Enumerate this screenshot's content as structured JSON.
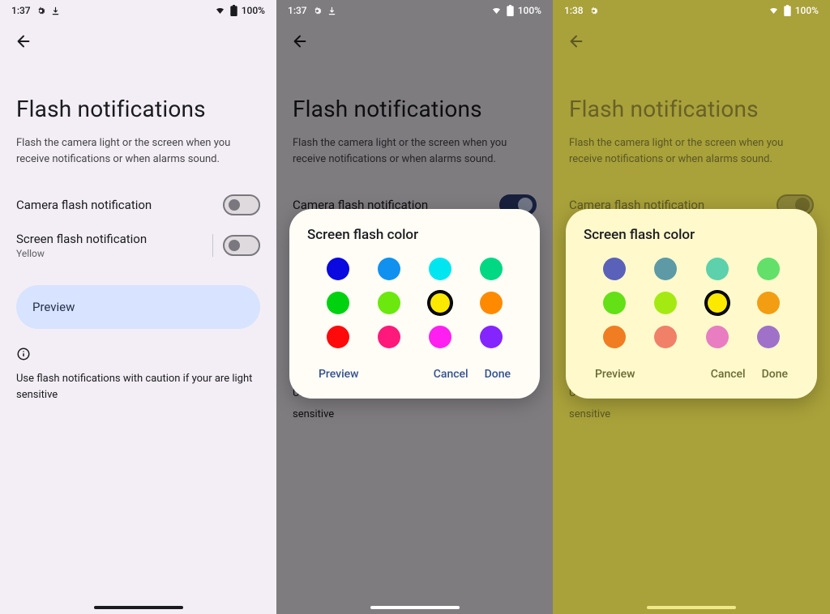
{
  "panel1": {
    "status": {
      "time": "1:37",
      "battery": "100%"
    },
    "title": "Flash notifications",
    "subtitle": "Flash the camera light or the screen when you receive notifications or when alarms sound.",
    "camera_row": "Camera flash notification",
    "screen_row": "Screen flash notification",
    "screen_row_sub": "Yellow",
    "preview": "Preview",
    "caution": "Use flash notifications with caution if your are light sensitive"
  },
  "panel2": {
    "status": {
      "time": "1:37",
      "battery": "100%"
    },
    "title": "Flash notifications",
    "subtitle": "Flash the camera light or the screen when you receive notifications or when alarms sound.",
    "dialog": {
      "title": "Screen flash color",
      "preview": "Preview",
      "cancel": "Cancel",
      "done": "Done",
      "colors": [
        "#0909e0",
        "#1091f0",
        "#00e6f0",
        "#00d884",
        "#00d210",
        "#6be80e",
        "#fbe900",
        "#ff8a00",
        "#ff0a0a",
        "#ff197a",
        "#ff1ff0",
        "#8425ff"
      ],
      "selected_index": 6
    },
    "caution": "Use flash notifications with caution if your are light sensitive"
  },
  "panel3": {
    "status": {
      "time": "1:38",
      "battery": "100%"
    },
    "title": "Flash notifications",
    "subtitle": "Flash the camera light or the screen when you receive notifications or when alarms sound.",
    "dialog": {
      "title": "Screen flash color",
      "preview": "Preview",
      "cancel": "Cancel",
      "done": "Done",
      "colors": [
        "#5a61b9",
        "#5d9aa6",
        "#5cd1ab",
        "#62e06a",
        "#63e016",
        "#a4ea12",
        "#fbe900",
        "#f39d12",
        "#f07d22",
        "#f18068",
        "#e87dc1",
        "#a071c9"
      ],
      "selected_index": 6
    },
    "caution": "sensitive"
  }
}
